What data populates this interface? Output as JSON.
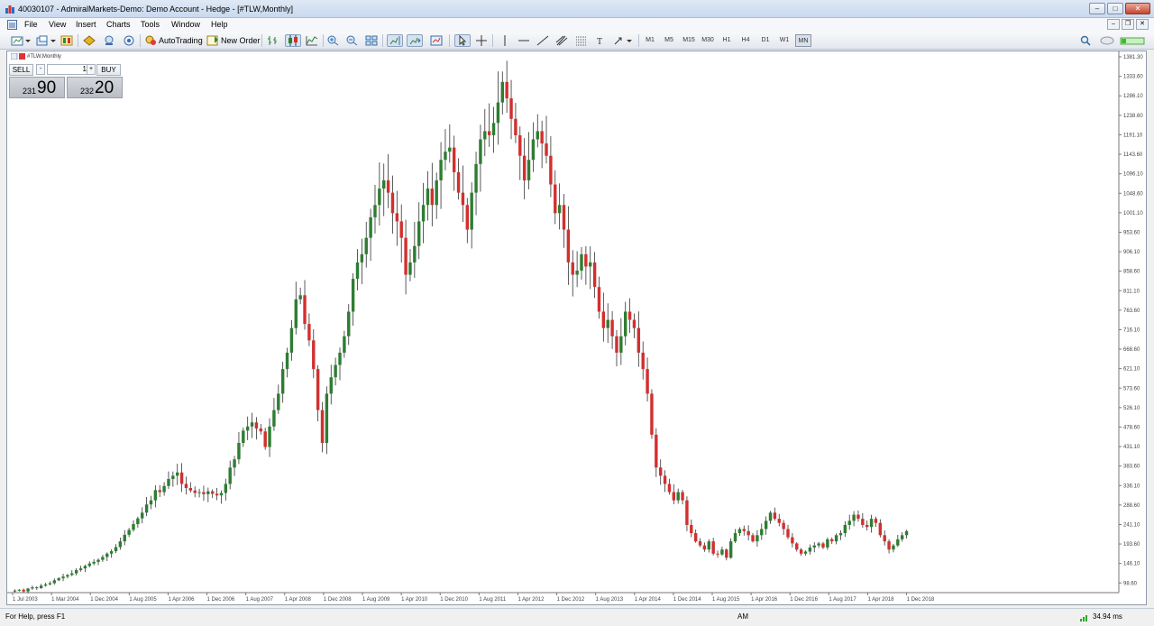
{
  "window": {
    "title": "40030107 - AdmiralMarkets-Demo: Demo Account - Hedge - [#TLW,Monthly]",
    "buttons": [
      "–",
      "□",
      "✕"
    ]
  },
  "menu": {
    "items": [
      "File",
      "View",
      "Insert",
      "Charts",
      "Tools",
      "Window",
      "Help"
    ],
    "mdi_buttons": [
      "–",
      "❒",
      "✕"
    ]
  },
  "toolbar": {
    "autotrading_label": "AutoTrading",
    "new_order_label": "New Order",
    "timeframes": [
      "M1",
      "M5",
      "M15",
      "M30",
      "H1",
      "H4",
      "D1",
      "W1",
      "MN"
    ],
    "active_timeframe": "MN",
    "icons": [
      "new-chart-icon",
      "profiles-icon",
      "market-watch-icon",
      "navigator-icon",
      "terminal-icon",
      "strategy-tester-icon",
      "bar-chart-icon",
      "candlestick-icon",
      "line-chart-icon",
      "zoom-in-icon",
      "zoom-out-icon",
      "tile-windows-icon",
      "chart-shift-icon",
      "autoscroll-icon",
      "templates-icon",
      "cursor-icon",
      "crosshair-icon",
      "vertical-line-icon",
      "horizontal-line-icon",
      "trendline-icon",
      "equidistant-channel-icon",
      "fibonacci-icon",
      "text-icon",
      "arrows-icon",
      "search-icon",
      "chat-icon",
      "signal-strength-icon"
    ]
  },
  "chart_pane": {
    "label": "#TLW,Monthly"
  },
  "one_click": {
    "sell_label": "SELL",
    "buy_label": "BUY",
    "lot": "1",
    "sell_price_small": "231",
    "sell_price_big": "90",
    "buy_price_small": "232",
    "buy_price_big": "20"
  },
  "status": {
    "help": "For Help, press F1",
    "session": "AM",
    "ping": "34.94 ms"
  },
  "colors": {
    "bull": "#2e7d32",
    "bear": "#d32f2f",
    "wick": "#333333",
    "background": "#ffffff"
  },
  "chart_data": {
    "type": "candlestick",
    "symbol": "#TLW",
    "timeframe": "Monthly",
    "y_ticks": [
      "1381.30",
      "1333.60",
      "1286.10",
      "1238.60",
      "1191.10",
      "1143.60",
      "1096.10",
      "1048.60",
      "1001.10",
      "953.60",
      "906.10",
      "858.60",
      "811.10",
      "763.60",
      "716.10",
      "668.60",
      "621.10",
      "573.60",
      "526.10",
      "478.60",
      "431.10",
      "383.60",
      "336.10",
      "288.60",
      "241.10",
      "193.60",
      "146.10",
      "98.60"
    ],
    "x_ticks": [
      "1 Jul 2003",
      "1 Mar 2004",
      "1 Dec 2004",
      "1 Aug 2005",
      "1 Apr 2006",
      "1 Dec 2006",
      "1 Aug 2007",
      "1 Apr 2008",
      "1 Dec 2008",
      "1 Aug 2009",
      "1 Apr 2010",
      "1 Dec 2010",
      "1 Aug 2011",
      "1 Apr 2012",
      "1 Dec 2012",
      "1 Aug 2013",
      "1 Apr 2014",
      "1 Dec 2014",
      "1 Aug 2015",
      "1 Apr 2016",
      "1 Dec 2016",
      "1 Aug 2017",
      "1 Apr 2018",
      "1 Dec 2018"
    ],
    "ylim": [
      75,
      1390
    ],
    "closes": [
      80,
      82,
      78,
      85,
      88,
      86,
      92,
      95,
      98,
      105,
      110,
      114,
      118,
      122,
      130,
      134,
      140,
      146,
      150,
      155,
      162,
      170,
      176,
      186,
      200,
      216,
      228,
      242,
      256,
      270,
      290,
      300,
      325,
      320,
      335,
      352,
      360,
      368,
      340,
      330,
      324,
      318,
      320,
      315,
      322,
      316,
      312,
      318,
      340,
      380,
      400,
      440,
      470,
      480,
      490,
      475,
      468,
      430,
      480,
      520,
      560,
      620,
      660,
      720,
      790,
      800,
      730,
      690,
      620,
      520,
      440,
      560,
      600,
      630,
      660,
      700,
      760,
      840,
      880,
      900,
      940,
      990,
      1020,
      1060,
      1080,
      1050,
      1000,
      980,
      940,
      850,
      880,
      920,
      980,
      1020,
      1060,
      1020,
      1080,
      1130,
      1150,
      1160,
      1100,
      1050,
      1020,
      960,
      1050,
      1120,
      1180,
      1200,
      1190,
      1220,
      1270,
      1320,
      1280,
      1230,
      1190,
      1140,
      1080,
      1130,
      1180,
      1200,
      1170,
      1140,
      1070,
      1000,
      1020,
      960,
      880,
      850,
      860,
      900,
      870,
      880,
      820,
      760,
      720,
      740,
      700,
      660,
      700,
      760,
      740,
      720,
      660,
      620,
      560,
      460,
      380,
      360,
      340,
      320,
      300,
      320,
      300,
      240,
      220,
      200,
      190,
      180,
      200,
      170,
      168,
      180,
      160,
      200,
      220,
      230,
      225,
      215,
      200,
      215,
      230,
      250,
      270,
      255,
      245,
      230,
      210,
      195,
      180,
      170,
      175,
      185,
      190,
      195,
      185,
      205,
      200,
      215,
      220,
      240,
      250,
      265,
      255,
      240,
      235,
      255,
      245,
      215,
      200,
      180,
      190,
      205,
      215,
      225
    ],
    "note_last": "230.00"
  }
}
